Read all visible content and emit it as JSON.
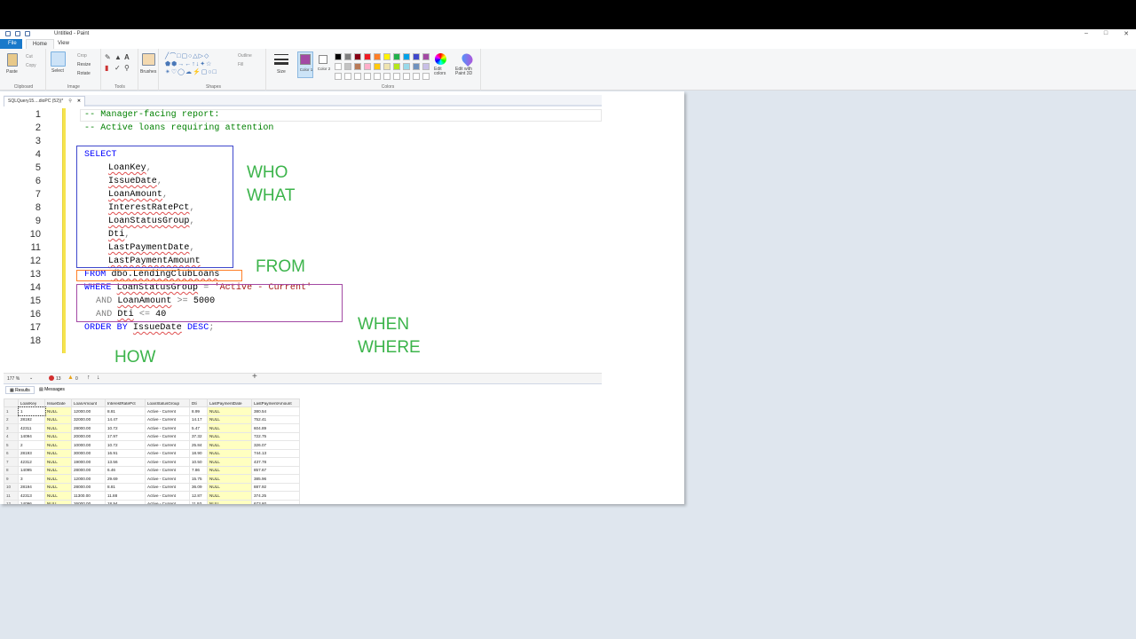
{
  "paint": {
    "window_title": "Untitled - Paint",
    "menu": {
      "file": "File",
      "home": "Home",
      "view": "View"
    },
    "ribbon": {
      "clipboard": {
        "paste": "Paste",
        "cut": "Cut",
        "copy": "Copy",
        "label": "Clipboard"
      },
      "image": {
        "select": "Select",
        "crop": "Crop",
        "resize": "Resize",
        "rotate": "Rotate",
        "label": "Image"
      },
      "tools_label": "Tools",
      "brushes": "Brushes",
      "shapes": {
        "outline": "Outline",
        "fill": "Fill",
        "label": "Shapes"
      },
      "size": "Size",
      "color1": "Color 1",
      "color2": "Color 2",
      "colors_label": "Colors",
      "edit_colors": "Edit colors",
      "edit_paint3d": "Edit with Paint 3D",
      "palette_row1": [
        "#000000",
        "#7f7f7f",
        "#880015",
        "#ed1c24",
        "#ff7f27",
        "#fff200",
        "#22b14c",
        "#00a2e8",
        "#3f48cc",
        "#a349a4"
      ],
      "palette_row2": [
        "#ffffff",
        "#c3c3c3",
        "#b97a57",
        "#ffaec9",
        "#ffc90e",
        "#efe4b0",
        "#b5e61d",
        "#99d9ea",
        "#7092be",
        "#c8bfe7"
      ],
      "color1_value": "#a349a4",
      "color2_value": "#ffffff"
    }
  },
  "ssms": {
    "doc_tab": "SQLQuery15....dioPC (52))*",
    "lines": [
      "1",
      "2",
      "3",
      "4",
      "5",
      "6",
      "7",
      "8",
      "9",
      "10",
      "11",
      "12",
      "13",
      "14",
      "15",
      "16",
      "17",
      "18"
    ],
    "code": {
      "l1": "-- Manager-facing report:",
      "l2": "-- Active loans requiring attention",
      "select": "SELECT",
      "c_loankey": "LoanKey",
      "c_issuedate": "IssueDate",
      "c_loanamount": "LoanAmount",
      "c_interest": "InterestRatePct",
      "c_status": "LoanStatusGroup",
      "c_dti": "Dti",
      "c_lastpaydate": "LastPaymentDate",
      "c_lastpayamt": "LastPaymentAmount",
      "comma": ",",
      "from_kw": "FROM",
      "from_tbl": "dbo.LendingClubLoans",
      "where_kw": "WHERE",
      "where_col": "LoanStatusGroup",
      "eq": "=",
      "where_val": "'Active - Current'",
      "and": "AND",
      "amt_col": "LoanAmount",
      "gte": ">=",
      "amt_val": "5000",
      "dti_col": "Dti",
      "lte": "<=",
      "dti_val": "40",
      "order_kw": "ORDER BY",
      "order_col": "IssueDate",
      "desc_kw": "DESC",
      "semicolon": ";"
    },
    "annotations": {
      "who_what": "WHO\nWHAT",
      "from": "FROM",
      "when_where": "WHEN\nWHERE",
      "how": "HOW"
    },
    "annotation_color": "#3cb44b",
    "status": {
      "zoom": "177 %",
      "errors": "13",
      "warnings": "0"
    },
    "result_tabs": {
      "results": "Results",
      "messages": "Messages"
    },
    "columns": [
      "LoanKey",
      "IssueDate",
      "LoanAmount",
      "InterestRatePct",
      "LoanStatusGroup",
      "Dti",
      "LastPaymentDate",
      "LastPaymentAmount"
    ],
    "rows": [
      [
        "1",
        "1",
        "NULL",
        "12000.00",
        "8.81",
        "Active - Current",
        "8.99",
        "NULL",
        "380.54"
      ],
      [
        "2",
        "28192",
        "NULL",
        "32000.00",
        "14.47",
        "Active - Current",
        "14.17",
        "NULL",
        "752.41"
      ],
      [
        "3",
        "42311",
        "NULL",
        "28000.00",
        "10.72",
        "Active - Current",
        "5.47",
        "NULL",
        "604.89"
      ],
      [
        "4",
        "14094",
        "NULL",
        "20000.00",
        "17.97",
        "Active - Current",
        "37.32",
        "NULL",
        "722.75"
      ],
      [
        "5",
        "2",
        "NULL",
        "10000.00",
        "10.72",
        "Active - Current",
        "25.84",
        "NULL",
        "326.07"
      ],
      [
        "6",
        "28193",
        "NULL",
        "30000.00",
        "16.91",
        "Active - Current",
        "18.90",
        "NULL",
        "744.13"
      ],
      [
        "7",
        "42312",
        "NULL",
        "19000.00",
        "13.56",
        "Active - Current",
        "10.50",
        "NULL",
        "437.78"
      ],
      [
        "8",
        "14095",
        "NULL",
        "28000.00",
        "6.46",
        "Active - Current",
        "7.86",
        "NULL",
        "857.67"
      ],
      [
        "9",
        "3",
        "NULL",
        "12000.00",
        "29.69",
        "Active - Current",
        "15.75",
        "NULL",
        "385.96"
      ],
      [
        "10",
        "28194",
        "NULL",
        "28000.00",
        "8.81",
        "Active - Current",
        "36.09",
        "NULL",
        "887.92"
      ],
      [
        "11",
        "42313",
        "NULL",
        "11300.00",
        "11.88",
        "Active - Current",
        "12.87",
        "NULL",
        "374.25"
      ],
      [
        "12",
        "14096",
        "NULL",
        "26000.00",
        "18.94",
        "Active - Current",
        "11.93",
        "NULL",
        "673.60"
      ]
    ]
  }
}
